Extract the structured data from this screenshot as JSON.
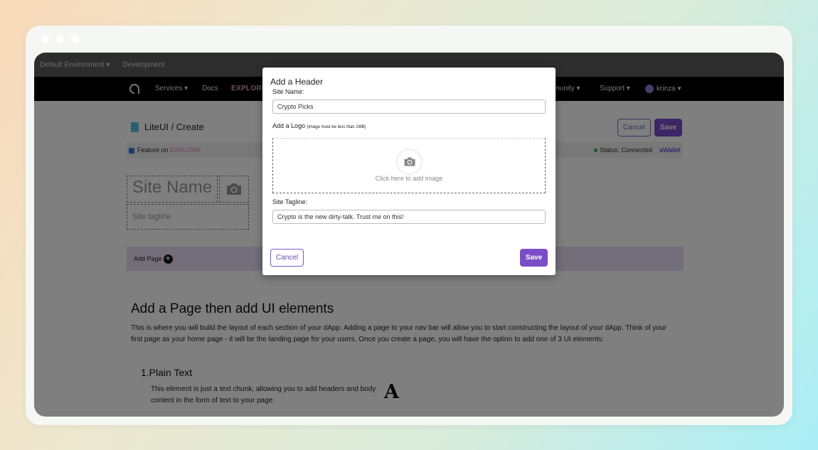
{
  "env_bar": {
    "environment": "Default Environment ▾",
    "development": "Development"
  },
  "nav": {
    "services": "Services ▾",
    "docs": "Docs",
    "explore": "EXPLORE",
    "community": "mmunity ▾",
    "support": "Support ▾",
    "user": "krinza ▾"
  },
  "page": {
    "breadcrumb": "LiteUI / Create",
    "cancel_label": "Cancel",
    "save_label": "Save",
    "feature_label": "Feature on",
    "feature_brand": "EXPLORE",
    "status": "Status: Connected",
    "wallet": "aWallet",
    "site_name_placeholder": "Site Name",
    "site_tagline_placeholder": "Site tagline",
    "add_page_label": "Add Page",
    "heading": "Add a Page then add UI elements",
    "paragraph": "This is where you will build the layout of each section of your dApp. Adding a page to your nav bar will allow you to start constructing the layout of your dApp. Think of your first page as your home page - it will be the landing page for your users. Once you create a page, you will have the option to add one of 3 UI elements:",
    "subheading": "1.Plain Text",
    "subparagraph": "This element is just a text chunk, allowing you to add headers and body content in the form of text to your page.",
    "text_icon_glyph": "A"
  },
  "modal": {
    "title": "Add a Header",
    "site_name_label": "Site Name:",
    "site_name_value": "Crypto Picks",
    "logo_label": "Add a Logo",
    "logo_note": "(image must be less than 1MB)",
    "upload_text": "Click here to add image",
    "tagline_label": "Site Tagline:",
    "tagline_value": "Crypto is the new dirty-talk. Trust me on this!",
    "cancel_label": "Cancel",
    "save_label": "Save"
  },
  "colors": {
    "accent": "#7a4cc8",
    "add_page_bar": "#e6dcf5",
    "overlay": "rgba(0,0,0,0.5)"
  },
  "icons": [
    "app-logo-icon",
    "book-icon",
    "camera-icon",
    "plus-circle-icon",
    "avatar-icon",
    "status-dot-icon"
  ]
}
